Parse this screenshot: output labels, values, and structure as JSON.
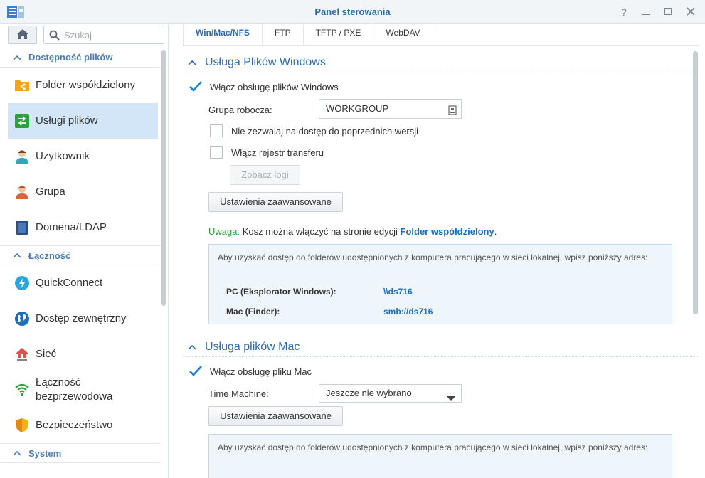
{
  "window": {
    "title": "Panel sterowania",
    "controls": [
      "help-icon",
      "minimize-icon",
      "maximize-icon",
      "close-icon"
    ]
  },
  "sidebar": {
    "search_placeholder": "Szukaj",
    "sections": [
      {
        "label": "Dostępność plików",
        "items": [
          {
            "label": "Folder współdzielony",
            "icon": "shared-folder-icon",
            "active": false
          },
          {
            "label": "Usługi plików",
            "icon": "file-services-icon",
            "active": true
          },
          {
            "label": "Użytkownik",
            "icon": "user-icon",
            "active": false
          },
          {
            "label": "Grupa",
            "icon": "group-icon",
            "active": false
          },
          {
            "label": "Domena/LDAP",
            "icon": "domain-icon",
            "active": false
          }
        ]
      },
      {
        "label": "Łączność",
        "items": [
          {
            "label": "QuickConnect",
            "icon": "quickconnect-icon",
            "active": false
          },
          {
            "label": "Dostęp zewnętrzny",
            "icon": "globe-icon",
            "active": false
          },
          {
            "label": "Sieć",
            "icon": "network-icon",
            "active": false
          },
          {
            "label": "Łączność bezprzewodowa",
            "line1": "Łączność",
            "line2": "bezprzewodowa",
            "icon": "wifi-icon",
            "active": false
          },
          {
            "label": "Bezpieczeństwo",
            "icon": "shield-icon",
            "active": false
          }
        ]
      },
      {
        "label": "System",
        "items": []
      }
    ]
  },
  "tabs": [
    {
      "label": "Win/Mac/NFS",
      "active": true
    },
    {
      "label": "FTP",
      "active": false
    },
    {
      "label": "TFTP / PXE",
      "active": false
    },
    {
      "label": "WebDAV",
      "active": false
    }
  ],
  "windows_section": {
    "title": "Usługa Plików Windows",
    "enable_label": "Włącz obsługę plików Windows",
    "enable_checked": true,
    "workgroup_label": "Grupa robocza:",
    "workgroup_value": "WORKGROUP",
    "prev_versions_label": "Nie zezwalaj na dostęp do poprzednich wersji",
    "prev_versions_checked": false,
    "transfer_log_label": "Włącz rejestr transferu",
    "transfer_log_checked": false,
    "view_logs_button": "Zobacz logi",
    "advanced_button": "Ustawienia zaawansowane",
    "note_prefix": "Uwaga:",
    "note_text": " Kosz można włączyć na stronie edycji ",
    "note_link": "Folder współdzielony",
    "note_suffix": ".",
    "info_text": "Aby uzyskać dostęp do folderów udostępnionych z komputera pracującego w sieci lokalnej, wpisz poniższy adres:",
    "pc_label": "PC (Eksplorator Windows):",
    "pc_value": "\\\\ds716",
    "mac_label": "Mac (Finder):",
    "mac_value": "smb://ds716"
  },
  "mac_section": {
    "title": "Usługa plików Mac",
    "enable_label": "Włącz obsługę pliku Mac",
    "enable_checked": true,
    "time_machine_label": "Time Machine:",
    "time_machine_value": "Jeszcze nie wybrano",
    "advanced_button": "Ustawienia zaawansowane",
    "info_text": "Aby uzyskać dostęp do folderów udostępnionych z komputera pracującego w sieci lokalnej, wpisz poniższy adres:"
  },
  "colors": {
    "accent": "#2a6ab0",
    "active_nav": "#d3e6f7",
    "checkbox_check": "#1a7fd6",
    "note_green": "#2e9b40",
    "info_bg": "#eef6fc"
  }
}
